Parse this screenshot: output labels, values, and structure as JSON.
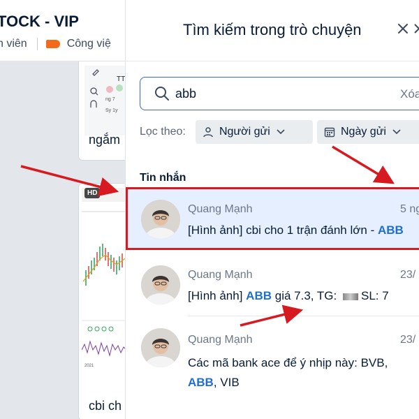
{
  "background_chat": {
    "title": "TOCK - VIP",
    "subtitle_members": "h viên",
    "subtitle_tag": "Công việ",
    "card1_caption": "ngắm",
    "card2_caption": "cbi ch",
    "hd_badge": "HD"
  },
  "search_panel": {
    "title": "Tìm kiếm trong trò chuyện",
    "search": {
      "value": "abb",
      "clear_label": "Xóa"
    },
    "filter": {
      "label": "Lọc theo:",
      "sender_label": "Người gửi",
      "date_label": "Ngày gửi"
    },
    "section_title": "Tin nhắn",
    "messages": [
      {
        "sender": "Quang Mạnh",
        "time": "5 ng",
        "text_before": "[Hình ảnh] cbi cho 1 trận đánh lớn - ",
        "highlight": "ABB",
        "text_after": ""
      },
      {
        "sender": "Quang Mạnh",
        "time": "23/",
        "text_before": "[Hình ảnh] ",
        "highlight": "ABB",
        "text_after": " giá 7.3, TG: ",
        "text_tail": "SL: 7"
      },
      {
        "sender": "Quang Mạnh",
        "time": "23/",
        "text_before": "Các mã bank ace để ý nhịp này: BVB, ",
        "highlight": "ABB",
        "text_after": ", VIB"
      }
    ]
  },
  "colors": {
    "accent_blue": "#1f6fcf",
    "search_border": "#3b6bb5",
    "active_row": "#e5efff",
    "annotation_red": "#d71920",
    "tag_orange": "#f26b1d"
  }
}
